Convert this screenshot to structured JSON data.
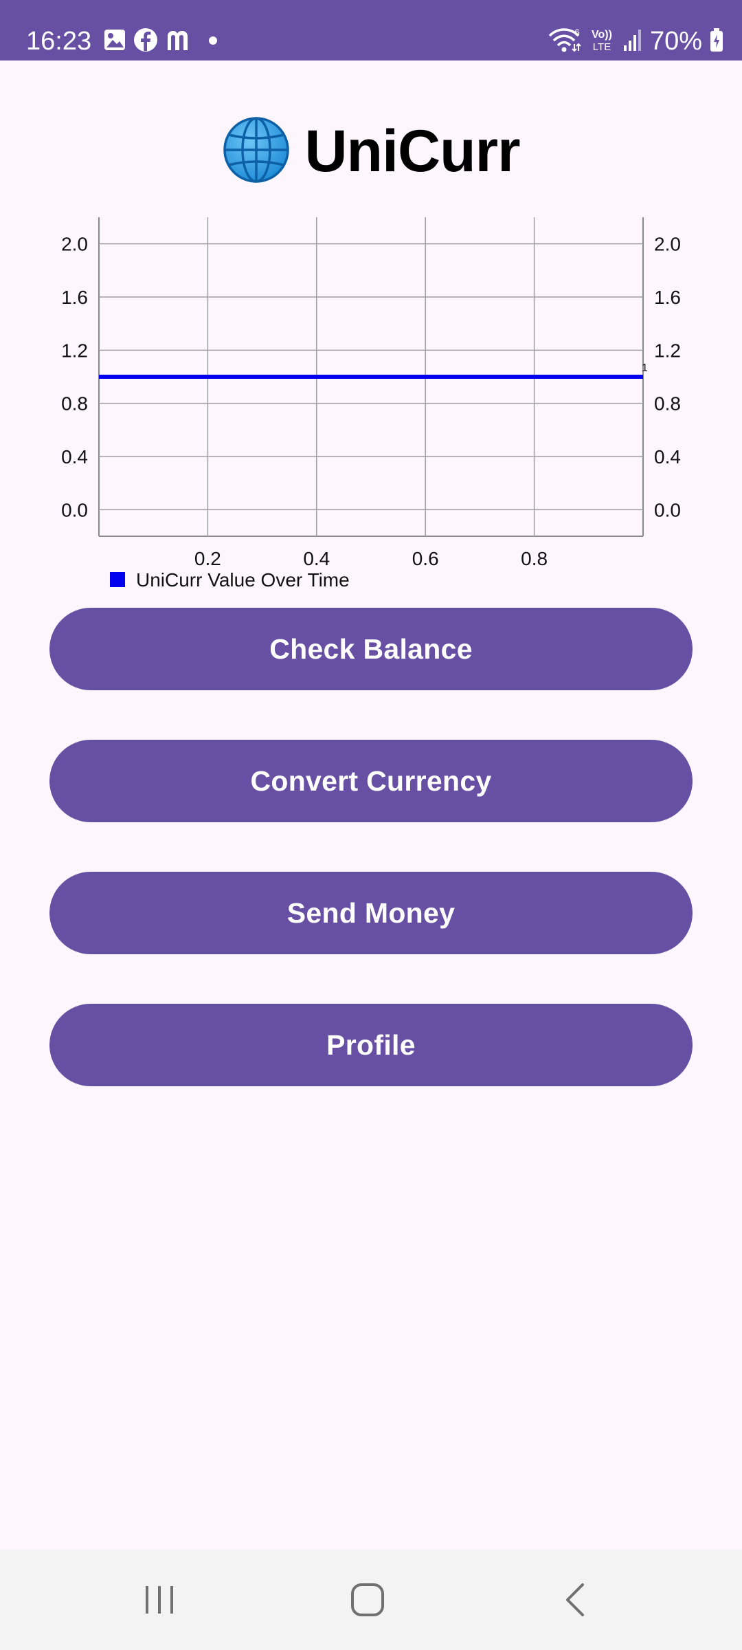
{
  "status_bar": {
    "time": "16:23",
    "battery": "70%",
    "left_icons": [
      "gallery-icon",
      "facebook-icon",
      "m-app-icon",
      "dot-icon"
    ],
    "right_icons": [
      "wifi-icon",
      "volte-icon",
      "signal-icon",
      "battery-icon"
    ],
    "network_label_top": "Vo))",
    "network_label_bottom": "LTE",
    "wifi_badge": "6"
  },
  "header": {
    "icon": "globe-icon",
    "title": "UniCurr"
  },
  "chart_data": {
    "type": "line",
    "series": [
      {
        "name": "UniCurr Value Over Time",
        "color": "#0000ee",
        "x": [
          0.0,
          1.0
        ],
        "y": [
          1.0,
          1.0
        ]
      }
    ],
    "x_ticks": [
      "0.2",
      "0.4",
      "0.6",
      "0.8"
    ],
    "x_tick_values": [
      0.2,
      0.4,
      0.6,
      0.8
    ],
    "y_ticks": [
      "0.0",
      "0.4",
      "0.8",
      "1.2",
      "1.6",
      "2.0"
    ],
    "y_tick_values": [
      0.0,
      0.4,
      0.8,
      1.2,
      1.6,
      2.0
    ],
    "xlim": [
      0.0,
      1.0
    ],
    "ylim": [
      -0.2,
      2.2
    ],
    "grid": true,
    "dual_y_axis": true,
    "legend": "bottom-left",
    "point_label": "1",
    "title": "",
    "xlabel": "",
    "ylabel": ""
  },
  "actions": {
    "check_balance": "Check Balance",
    "convert_currency": "Convert Currency",
    "send_money": "Send Money",
    "profile": "Profile"
  },
  "nav_bar": {
    "recents": "recents-icon",
    "home": "home-icon",
    "back": "back-icon"
  },
  "colors": {
    "primary": "#6750a4",
    "background": "#fdf7fd",
    "series": "#0000ee",
    "nav_background": "#f4f3f4"
  }
}
